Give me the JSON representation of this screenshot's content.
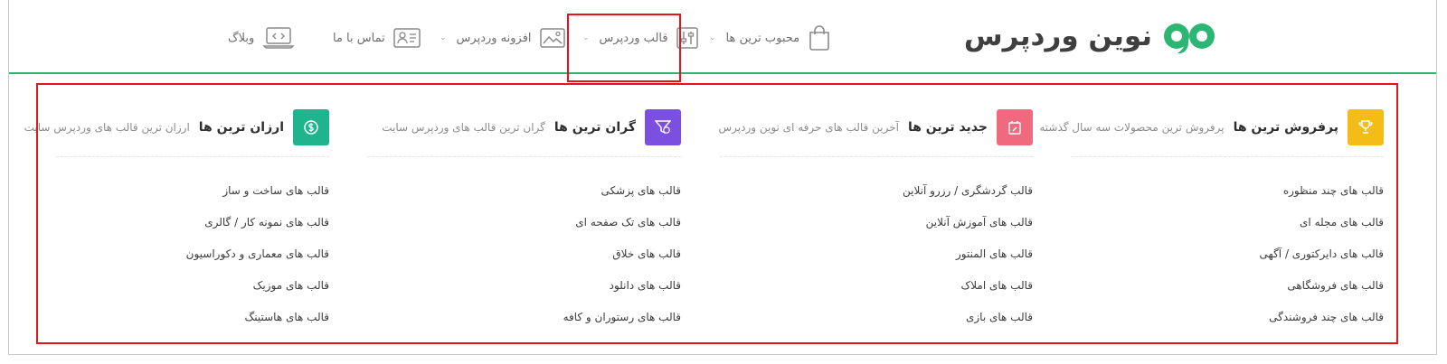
{
  "colors": {
    "accent_green": "#2bb673",
    "highlight_red": "#e2141c",
    "icon_yellow": "#f4bc16",
    "icon_pink": "#ef6a7f",
    "icon_purple": "#7b4fe0",
    "icon_teal": "#1fb38e"
  },
  "header": {
    "logo_text": "نوین وردپرس",
    "nav": [
      {
        "label": "محبوب ترین ها",
        "icon": "shopping-bag-icon",
        "has_dropdown": true
      },
      {
        "label": "قالب وردپرس",
        "icon": "sliders-icon",
        "has_dropdown": true
      },
      {
        "label": "افزونه وردپرس",
        "icon": "image-icon",
        "has_dropdown": true
      },
      {
        "label": "تماس با ما",
        "icon": "contact-card-icon",
        "has_dropdown": false
      },
      {
        "label": "وبلاگ",
        "icon": "laptop-code-icon",
        "has_dropdown": false
      }
    ]
  },
  "mega_menu": {
    "columns": [
      {
        "title": "پرفروش ترین ها",
        "subtitle": "پرفروش ترین محصولات سه سال گذشته",
        "icon": "trophy-icon",
        "items": [
          "قالب های چند منظوره",
          "قالب های مجله ای",
          "قالب های دایرکتوری / آگهی",
          "قالب های فروشگاهی",
          "قالب های چند فروشندگی"
        ]
      },
      {
        "title": "جدید ترین ها",
        "subtitle": "آخرین قالب های حرفه ای نوین وردپرس",
        "icon": "calendar-edit-icon",
        "items": [
          "قالب گردشگری / رزرو آنلاین",
          "قالب های آموزش آنلاین",
          "قالب های المنتور",
          "قالب های املاک",
          "قالب های بازی"
        ]
      },
      {
        "title": "گران ترین ها",
        "subtitle": "گران ترین قالب های وردپرس سایت",
        "icon": "price-filter-icon",
        "items": [
          "قالب های پزشکی",
          "قالب های تک صفحه ای",
          "قالب های خلاق",
          "قالب های دانلود",
          "قالب های رستوران و کافه"
        ]
      },
      {
        "title": "ارزان ترین ها",
        "subtitle": "ارزان ترین قالب های وردپرس سایت",
        "icon": "dollar-badge-icon",
        "items": [
          "قالب های ساخت و ساز",
          "قالب های نمونه کار / گالری",
          "قالب های معماری و دکوراسیون",
          "قالب های موزیک",
          "قالب های هاستینگ"
        ]
      }
    ]
  }
}
